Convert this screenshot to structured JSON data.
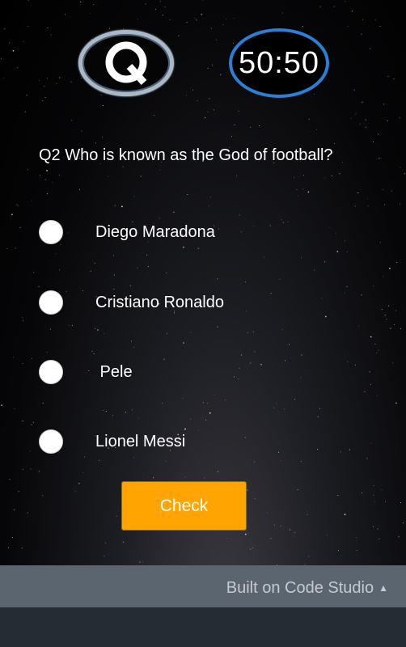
{
  "logo": {
    "letter": "Q"
  },
  "lifeline": {
    "label": "50:50"
  },
  "question": {
    "text": "Q2 Who is known as the God of football?"
  },
  "options": [
    {
      "label": "Diego Maradona",
      "selected": false
    },
    {
      "label": "Cristiano Ronaldo",
      "selected": false
    },
    {
      "label": " Pele",
      "selected": false
    },
    {
      "label": "Lionel Messi",
      "selected": false
    }
  ],
  "check_button": {
    "label": "Check"
  },
  "footer": {
    "label": "Built on Code Studio",
    "arrow": "▲"
  },
  "colors": {
    "accent_button": "#ffa400",
    "lifeline_ring": "#2b7fd6",
    "logo_ring": "#a9b9c9",
    "footer_bar": "#5a6570",
    "bottom_area": "#252c33"
  }
}
